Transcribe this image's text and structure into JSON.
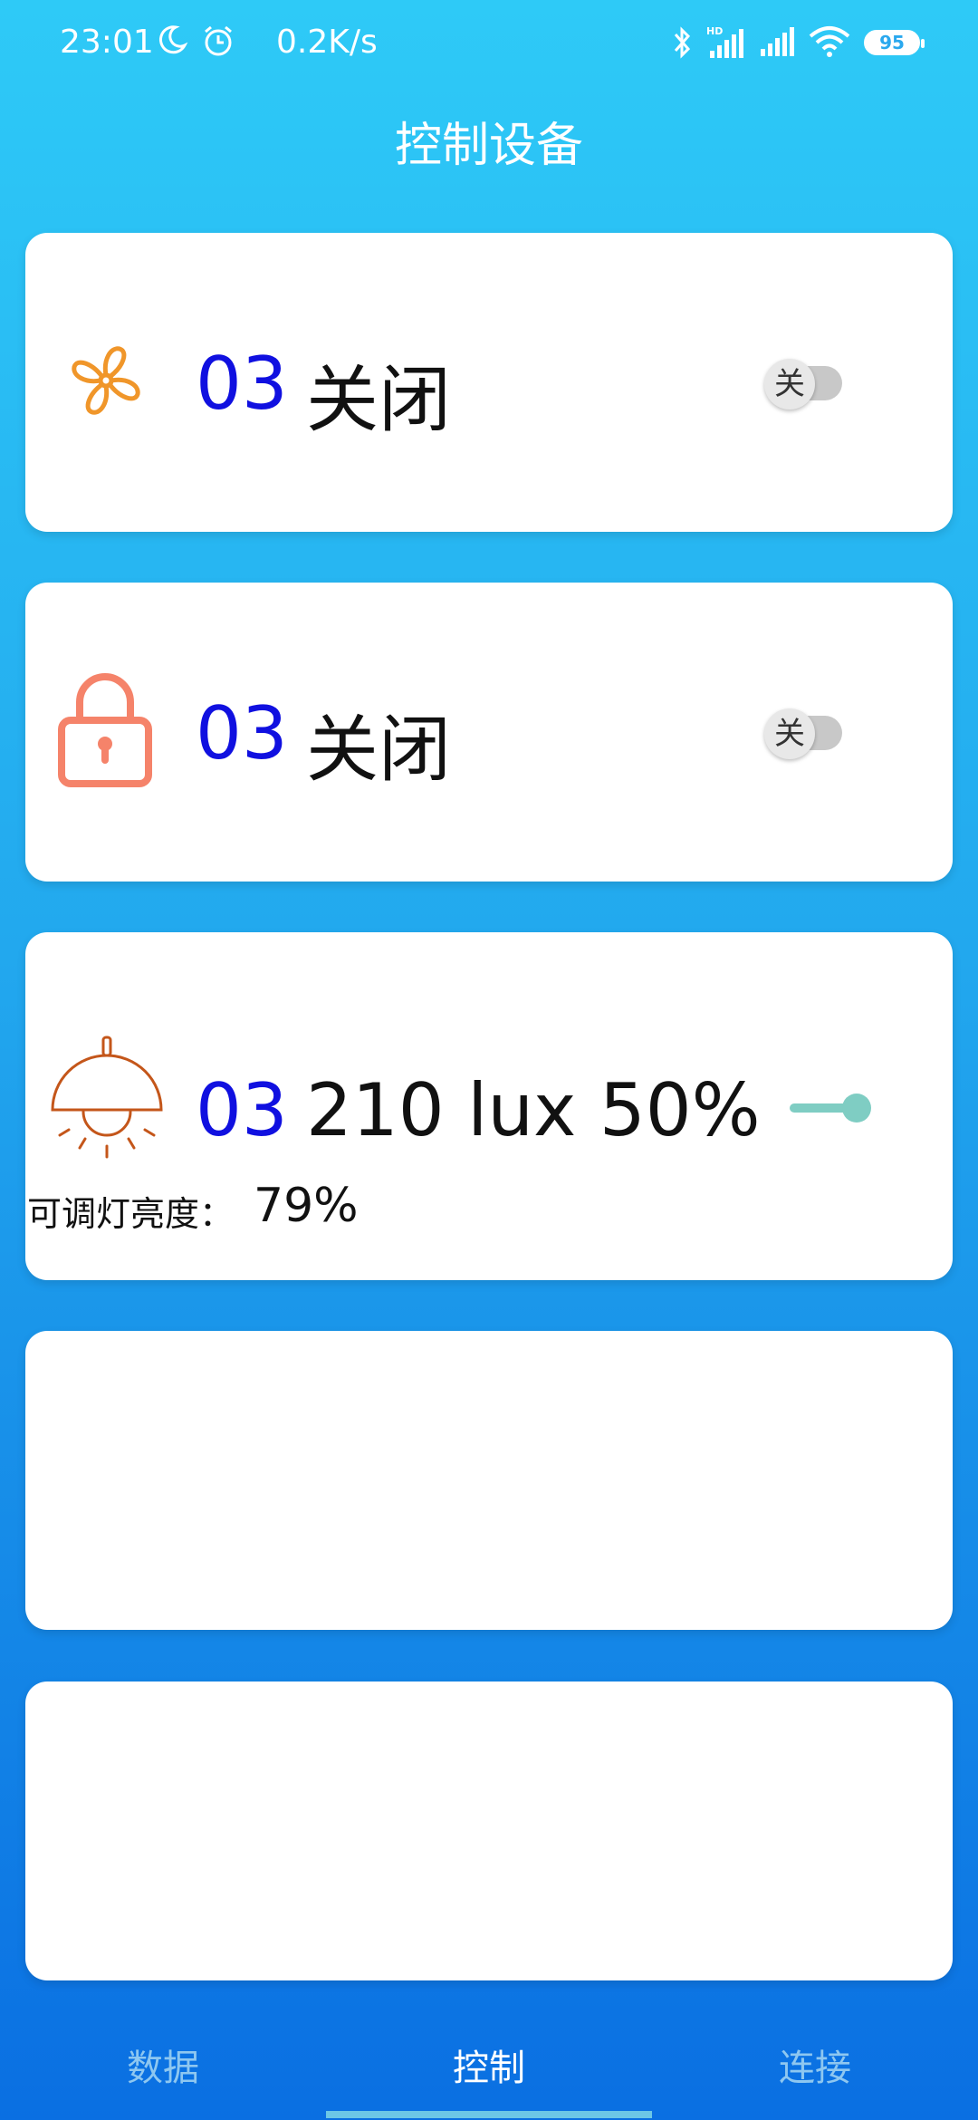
{
  "status_bar": {
    "time": "23:01",
    "net_speed": "0.2K/s",
    "battery": "95",
    "icons": [
      "moon-icon",
      "alarm-icon",
      "bluetooth-icon",
      "signal-hd-icon",
      "signal-icon",
      "wifi-icon",
      "battery-icon"
    ]
  },
  "header": {
    "title": "控制设备"
  },
  "devices": [
    {
      "icon": "fan-icon",
      "icon_color": "#f0962a",
      "id": "03",
      "state": "关闭",
      "toggle_label": "关"
    },
    {
      "icon": "lock-icon",
      "icon_color": "#f5836a",
      "id": "03",
      "state": "关闭",
      "toggle_label": "关"
    },
    {
      "icon": "lamp-icon",
      "icon_color": "#c4561a",
      "id": "03",
      "state": "210 lux  50%",
      "slider_value": 1.0,
      "label": "可调灯亮度：",
      "brightness": "79%"
    }
  ],
  "bottom_nav": {
    "items": [
      {
        "label": "数据",
        "active": false
      },
      {
        "label": "控制",
        "active": true
      },
      {
        "label": "连接",
        "active": false
      }
    ]
  },
  "colors": {
    "gradient_top": "#2ecaf7",
    "gradient_bottom": "#0a6fe2",
    "device_id": "#1010e0",
    "slider": "#7fcdc3"
  }
}
